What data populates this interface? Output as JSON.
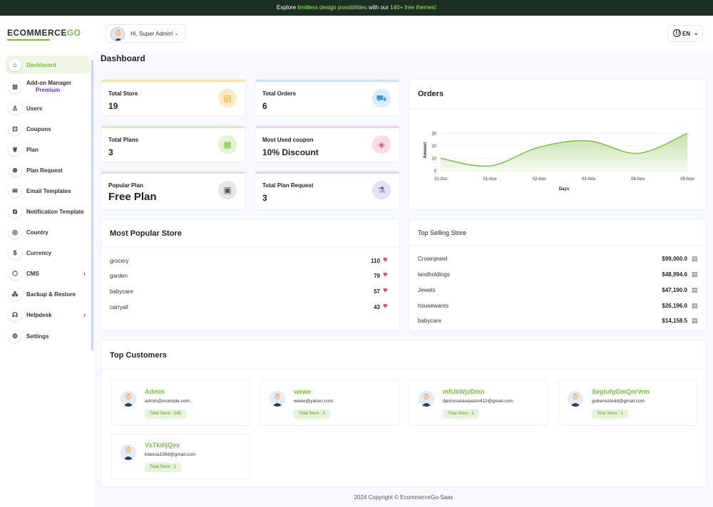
{
  "announcement": {
    "text_a": "Explore ",
    "highlight_a": "limitless design possibilities",
    "text_b": " with our ",
    "highlight_b": "140+ free themes!"
  },
  "brand": {
    "logo_main": "ECOMMERCE",
    "logo_accent": "GO"
  },
  "header": {
    "greeting": "Hi, Super Admin!",
    "language": "EN"
  },
  "sidebar": {
    "items": [
      {
        "label": "Dashboard",
        "icon": "home-icon"
      },
      {
        "label": "Add-on Manager",
        "sub": "Premium",
        "icon": "grid-icon"
      },
      {
        "label": "Users",
        "icon": "user-icon"
      },
      {
        "label": "Coupons",
        "icon": "gift-icon"
      },
      {
        "label": "Plan",
        "icon": "trophy-icon"
      },
      {
        "label": "Plan Request",
        "icon": "circle-x-icon"
      },
      {
        "label": "Email Templates",
        "icon": "mail-icon"
      },
      {
        "label": "Notification Template",
        "icon": "notification-icon"
      },
      {
        "label": "Country",
        "icon": "globe-icon"
      },
      {
        "label": "Currency",
        "icon": "dollar-icon"
      },
      {
        "label": "CMS",
        "icon": "box-icon",
        "arrow": "›"
      },
      {
        "label": "Backup & Restore",
        "icon": "backup-icon"
      },
      {
        "label": "Helpdesk",
        "icon": "headset-icon",
        "arrow": "›"
      },
      {
        "label": "Settings",
        "icon": "gear-icon"
      }
    ]
  },
  "page": {
    "title": "Dashboard"
  },
  "stats": [
    {
      "label": "Total Store",
      "value": "19",
      "color": "#f6e2b5",
      "icon": "store-icon"
    },
    {
      "label": "Total Orders",
      "value": "6",
      "color": "#cfe4f6",
      "icon": "cart-icon"
    },
    {
      "label": "Total Plans",
      "value": "3",
      "color": "#d7efc4",
      "icon": "plan-icon"
    },
    {
      "label": "Most Used coupon",
      "value": "10% Discount",
      "color": "#f8d3dc",
      "icon": "coupon-icon"
    },
    {
      "label": "Popular Plan",
      "value": "Free Plan",
      "color": "#e2e2e2",
      "icon": "doc-icon"
    },
    {
      "label": "Total Plan Request",
      "value": "3",
      "color": "#dcdaf0",
      "icon": "request-icon"
    }
  ],
  "orders_chart": {
    "title": "Orders"
  },
  "chart_data": {
    "type": "area",
    "title": "Orders",
    "xlabel": "Days",
    "ylabel": "Amount",
    "x": [
      "31-Oct",
      "01-Nov",
      "02-Nov",
      "03-Nov",
      "04-Nov",
      "05-Nov"
    ],
    "values": [
      10,
      4,
      19,
      24,
      14,
      30
    ],
    "yticks": [
      "0",
      "10",
      "20",
      "30"
    ],
    "ylim": [
      0,
      33
    ],
    "color": "#7bc043"
  },
  "popular_store": {
    "title": "Most Popular Store",
    "rows": [
      {
        "name": "grocery",
        "count": "110"
      },
      {
        "name": "garden",
        "count": "79"
      },
      {
        "name": "babycare",
        "count": "57"
      },
      {
        "name": "carryall",
        "count": "43"
      }
    ]
  },
  "top_selling": {
    "title": "Top Selling Store",
    "rows": [
      {
        "name": "Crownjewel",
        "amount": "$99,000.0"
      },
      {
        "name": "landholdings",
        "amount": "$48,994.6"
      },
      {
        "name": "Jewels",
        "amount": "$47,190.0"
      },
      {
        "name": "housewares",
        "amount": "$26,196.0"
      },
      {
        "name": "babycare",
        "amount": "$14,158.5"
      }
    ]
  },
  "top_customers": {
    "title": "Top Customers",
    "items": [
      {
        "name": "Admin",
        "email": "admin@example.com",
        "badge": "Total Store : 145"
      },
      {
        "name": "wewe",
        "email": "wewe@yahoo.com",
        "badge": "Total Store : 3"
      },
      {
        "name": "mfUbWjzDmh",
        "email": "djeinssavasquezn412@gmail.com",
        "badge": "Total Store : 1"
      },
      {
        "name": "SvgiufgGmQnrVrm",
        "email": "gutierreztedd@gmail.com",
        "badge": "Total Store : 1"
      },
      {
        "name": "VsTkdljQvs",
        "email": "kilanoa1988@gmail.com",
        "badge": "Total Store : 1"
      }
    ]
  },
  "footer": {
    "text": "2024 Copyright © EcommerceGo-Saas"
  },
  "colors": {
    "accent": "#7bc043",
    "dark": "#1b2f23",
    "heart": "#e04848"
  }
}
